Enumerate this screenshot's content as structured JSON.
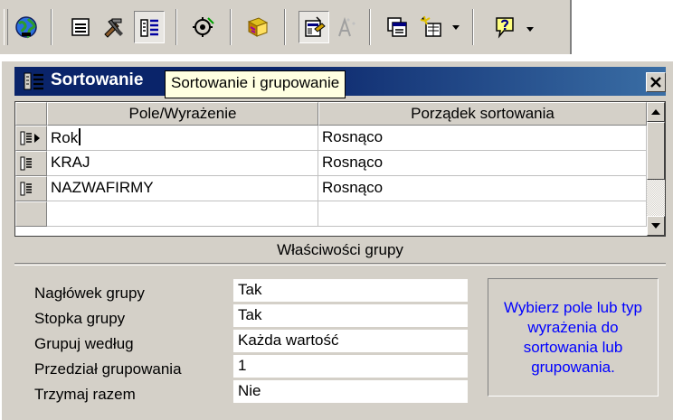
{
  "window": {
    "title": "Sortowanie",
    "tooltip": "Sortowanie i grupowanie",
    "close_label": "Zamknij"
  },
  "toolbar": {
    "icons": [
      "globe-icon",
      "properties-icon",
      "build-icon",
      "sorting-grouping-icon",
      "field-list-icon",
      "code-icon",
      "autoformat-icon",
      "toolbox-icon",
      "new-object-icon",
      "database-window-icon",
      "help-icon"
    ],
    "pressed": [
      "sorting-grouping-icon",
      "toolbox-icon"
    ]
  },
  "grid": {
    "columns": [
      "Pole/Wyrażenie",
      "Porządek sortowania"
    ],
    "rows": [
      {
        "field": "Rok",
        "order": "Rosnąco",
        "grouped": true,
        "current": true
      },
      {
        "field": "KRAJ",
        "order": "Rosnąco",
        "grouped": true,
        "current": false
      },
      {
        "field": "NAZWAFIRMY",
        "order": "Rosnąco",
        "grouped": true,
        "current": false
      },
      {
        "field": "",
        "order": "",
        "grouped": false,
        "current": false
      }
    ]
  },
  "group_properties": {
    "title": "Właściwości grupy",
    "properties": [
      {
        "label": "Nagłówek grupy",
        "value": "Tak"
      },
      {
        "label": "Stopka grupy",
        "value": "Tak"
      },
      {
        "label": "Grupuj według",
        "value": "Każda wartość"
      },
      {
        "label": "Przedział grupowania",
        "value": "1"
      },
      {
        "label": "Trzymaj razem",
        "value": "Nie"
      }
    ],
    "help_text": "Wybierz pole lub typ wyrażenia do sortowania lub grupowania."
  },
  "colors": {
    "titlebar": "#0a246a",
    "face": "#d4d0c8",
    "tooltip": "#ffffe1",
    "help_text": "#0000ff"
  }
}
